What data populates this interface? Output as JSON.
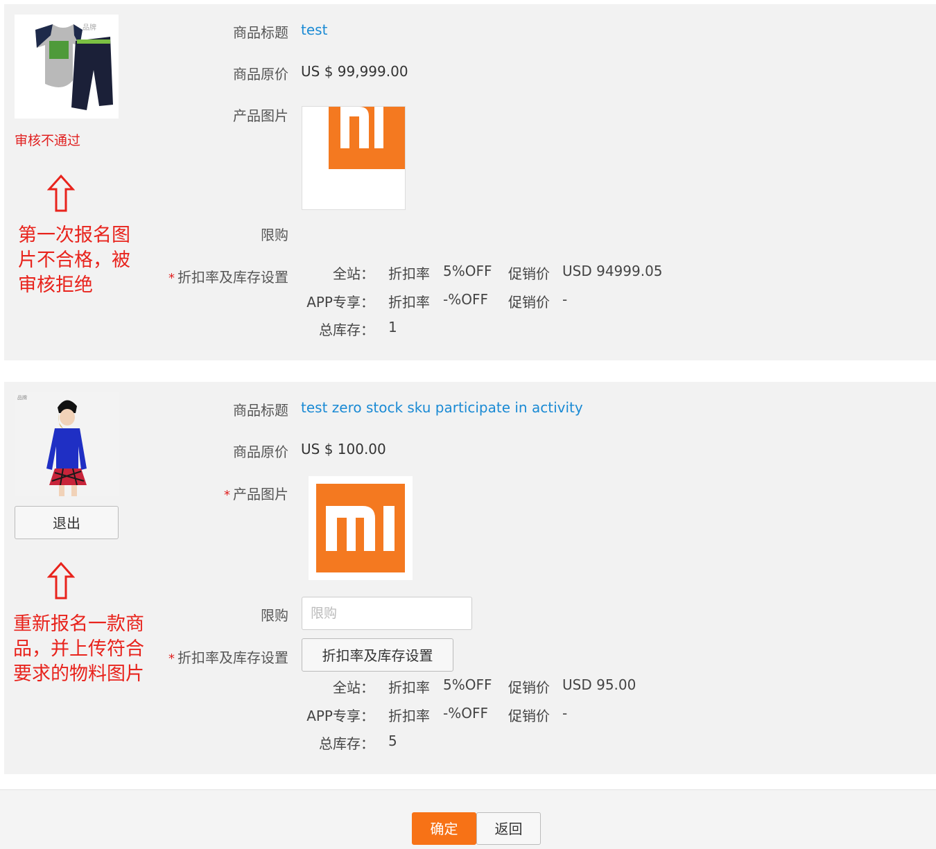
{
  "colors": {
    "link": "#1a8ad4",
    "danger": "#e02020",
    "annotation": "#e8231c",
    "primary": "#f77216",
    "panel": "#f2f2f2",
    "mi_orange": "#f47920"
  },
  "labels": {
    "title": "商品标题",
    "orig_price": "商品原价",
    "product_image": "产品图片",
    "limit": "限购",
    "discount_stock": "折扣率及库存设置",
    "required_mark": "*"
  },
  "stats": {
    "site": "全站：",
    "app": "APP专享：",
    "stock": "总库存：",
    "rate": "折扣率",
    "promo": "促销价"
  },
  "items": [
    {
      "title": "test",
      "orig_price": "US $ 99,999.00",
      "status": "审核不通过",
      "site_rate": "5%OFF",
      "site_promo": "USD 94999.05",
      "app_rate": "-%OFF",
      "app_promo": "-",
      "stock": "1",
      "note_lines": [
        "第一次报名图",
        "片不合格，被",
        "审核拒绝"
      ],
      "thumb_icon": "baby-clothes-image",
      "mi_icon": "mi-logo-cropped-image"
    },
    {
      "title": "test zero stock sku participate in activity",
      "orig_price": "US $ 100.00",
      "exit_label": "退出",
      "limit_placeholder": "限购",
      "discount_button": "折扣率及库存设置",
      "site_rate": "5%OFF",
      "site_promo": "USD 95.00",
      "app_rate": "-%OFF",
      "app_promo": "-",
      "stock": "5",
      "note_lines": [
        "重新报名一款商",
        "品，并上传符合",
        "要求的物料图片"
      ],
      "thumb_icon": "woman-model-image",
      "mi_icon": "mi-logo-image"
    }
  ],
  "footer": {
    "confirm": "确定",
    "back": "返回"
  }
}
